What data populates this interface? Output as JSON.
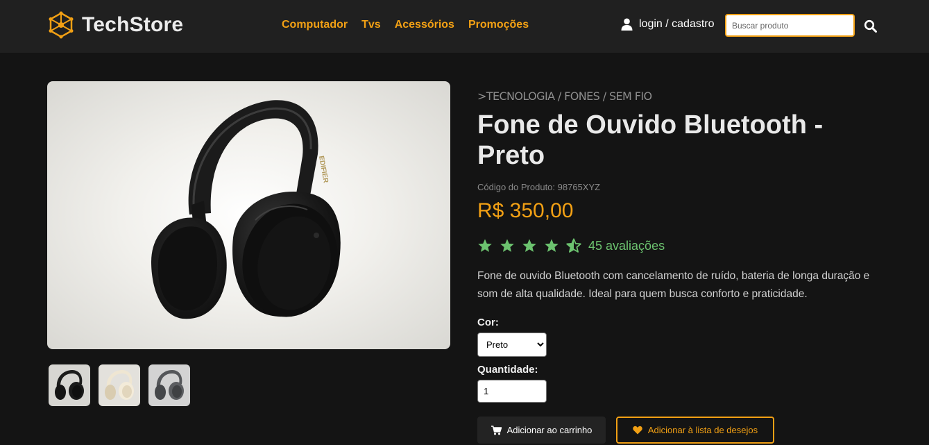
{
  "brand": {
    "name": "TechStore",
    "logo_icon": "hexagon-network-icon",
    "accent": "#f2a014"
  },
  "nav": [
    {
      "label": "Computador"
    },
    {
      "label": "Tvs"
    },
    {
      "label": "Acessórios"
    },
    {
      "label": "Promoções"
    }
  ],
  "account": {
    "label": "login / cadastro",
    "icon": "user-icon"
  },
  "search": {
    "placeholder": "Buscar produto",
    "value": "",
    "icon": "search-icon"
  },
  "product": {
    "breadcrumb": ">TECNOLOGIA / FONES / SEM FIO",
    "title": "Fone de Ouvido Bluetooth - Preto",
    "code": "Código do Produto: 98765XYZ",
    "price": "R$ 350,00",
    "rating": {
      "stars": 4.5,
      "max": 5,
      "reviews_text": "45 avaliações",
      "color": "#6cc36f"
    },
    "description": "Fone de ouvido Bluetooth com cancelamento de ruído, bateria de longa duração e som de alta qualidade. Ideal para quem busca conforto e praticidade.",
    "color_label": "Cor:",
    "color_selected": "Preto",
    "quantity_label": "Quantidade:",
    "quantity_value": "1",
    "add_to_cart": "Adicionar ao carrinho",
    "add_to_wishlist": "Adicionar à lista de desejos",
    "thumbnails": [
      {
        "variant": "black"
      },
      {
        "variant": "cream"
      },
      {
        "variant": "gray"
      }
    ]
  }
}
